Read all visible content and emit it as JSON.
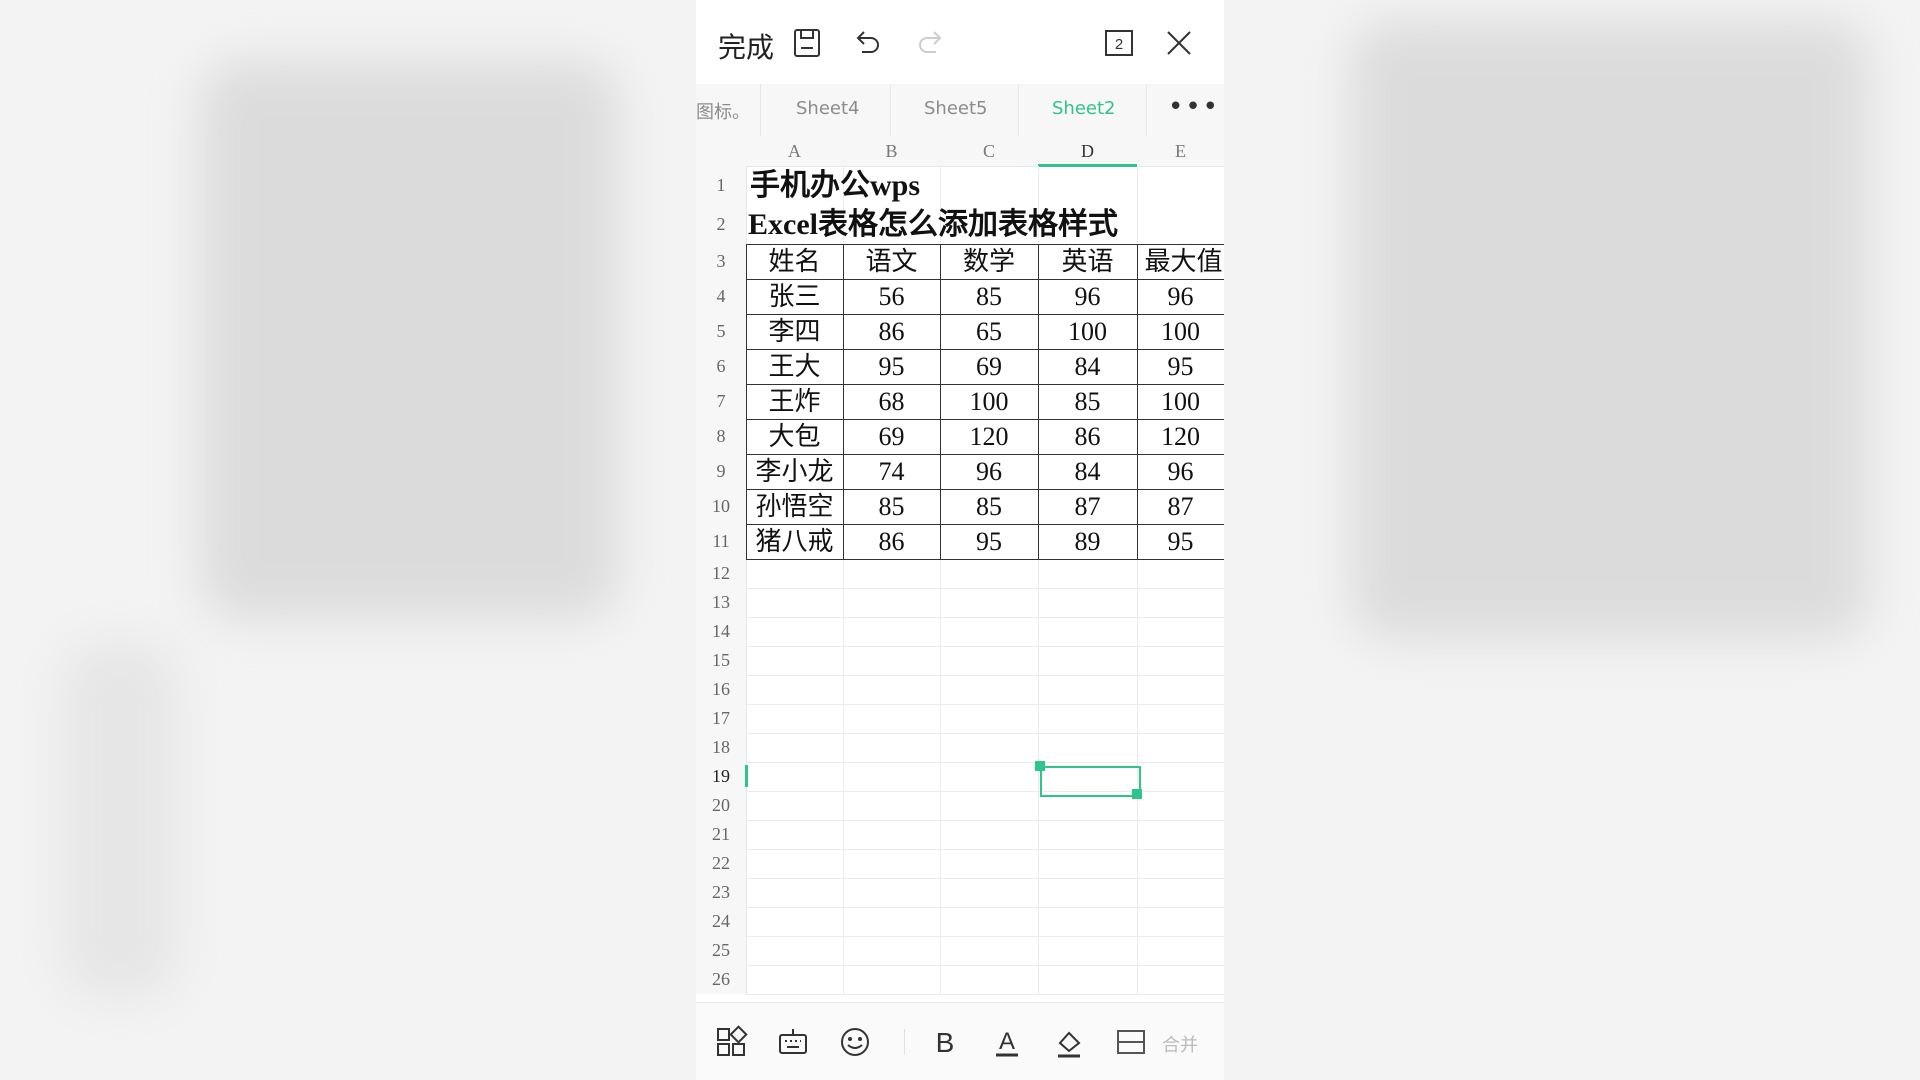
{
  "toolbar": {
    "done_label": "完成",
    "icons": [
      "save-icon",
      "undo-icon",
      "redo-icon",
      "window-count-icon",
      "close-icon"
    ],
    "window_count": "2"
  },
  "tabs": {
    "items": [
      "图标。",
      "Sheet4",
      "Sheet5",
      "Sheet2"
    ],
    "active": "Sheet2",
    "more_label": "•••"
  },
  "grid": {
    "columns": [
      "A",
      "B",
      "C",
      "D",
      "E"
    ],
    "active_column": "D",
    "rows": [
      "1",
      "2",
      "3",
      "4",
      "5",
      "6",
      "7",
      "8",
      "9",
      "10",
      "11",
      "12",
      "13",
      "14",
      "15",
      "16",
      "17",
      "18",
      "19",
      "20",
      "21",
      "22",
      "23",
      "24",
      "25",
      "26"
    ],
    "active_row": "19"
  },
  "sheet": {
    "title1": "手机办公wps",
    "title2": "Excel表格怎么添加表格样式",
    "headers": [
      "姓名",
      "语文",
      "数学",
      "英语",
      "最大值"
    ],
    "records": [
      [
        "张三",
        "56",
        "85",
        "96",
        "96"
      ],
      [
        "李四",
        "86",
        "65",
        "100",
        "100"
      ],
      [
        "王大",
        "95",
        "69",
        "84",
        "95"
      ],
      [
        "王炸",
        "68",
        "100",
        "85",
        "100"
      ],
      [
        "大包",
        "69",
        "120",
        "86",
        "120"
      ],
      [
        "李小龙",
        "74",
        "96",
        "84",
        "96"
      ],
      [
        "孙悟空",
        "85",
        "85",
        "87",
        "87"
      ],
      [
        "猪八戒",
        "86",
        "95",
        "89",
        "95"
      ]
    ]
  },
  "selection": {
    "cell": "D19"
  },
  "bottombar": {
    "icons": [
      "grid-apps-icon",
      "keyboard-icon",
      "emoji-icon",
      "bold-icon",
      "font-color-icon",
      "fill-color-icon",
      "merge-cells-icon"
    ],
    "merge_label": "合并",
    "accent": "#2ec48a"
  }
}
